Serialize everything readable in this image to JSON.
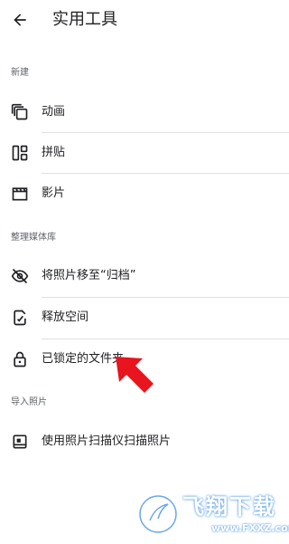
{
  "header": {
    "title": "实用工具",
    "back_icon": "arrow-back-icon"
  },
  "sections": [
    {
      "header": "新建",
      "items": [
        {
          "label": "动画",
          "icon": "animation-icon"
        },
        {
          "label": "拼贴",
          "icon": "collage-icon"
        },
        {
          "label": "影片",
          "icon": "movie-icon"
        }
      ]
    },
    {
      "header": "整理媒体库",
      "items": [
        {
          "label": "将照片移至“归档”",
          "icon": "archive-hide-icon"
        },
        {
          "label": "释放空间",
          "icon": "free-up-space-icon"
        },
        {
          "label": "已锁定的文件夹",
          "icon": "lock-icon"
        }
      ]
    },
    {
      "header": "导入照片",
      "items": [
        {
          "label": "使用照片扫描仪扫描照片",
          "icon": "photoscan-icon"
        }
      ]
    }
  ],
  "watermark": {
    "name": "飞翔下载",
    "domain": "www.FXXZ.com"
  },
  "colors": {
    "text_primary": "#202124",
    "text_secondary": "#5f6368",
    "divider": "#e0e0e0",
    "annotation_arrow": "#e8141e",
    "watermark_blue": "#6aa8e8"
  }
}
